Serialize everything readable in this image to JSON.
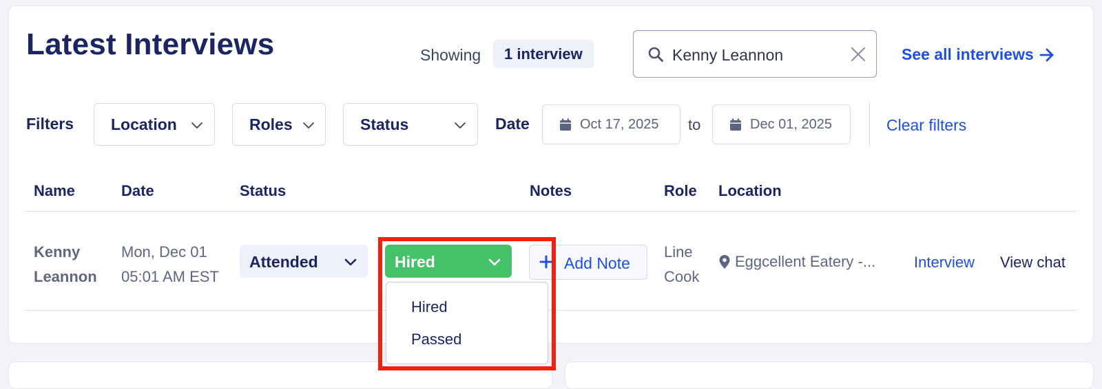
{
  "header": {
    "title": "Latest Interviews",
    "showing_label": "Showing",
    "count_badge": "1 interview",
    "see_all": "See all interviews"
  },
  "search": {
    "value": "Kenny Leannon",
    "icon": "search-icon",
    "clear_icon": "close-icon"
  },
  "filters": {
    "label": "Filters",
    "location": "Location",
    "roles": "Roles",
    "status": "Status",
    "date_label": "Date",
    "date_from": "Oct 17, 2025",
    "to_label": "to",
    "date_to": "Dec 01, 2025",
    "clear": "Clear filters"
  },
  "table": {
    "columns": {
      "name": "Name",
      "date": "Date",
      "status": "Status",
      "notes": "Notes",
      "role": "Role",
      "location": "Location"
    },
    "rows": [
      {
        "name_first": "Kenny",
        "name_last": "Leannon",
        "date_line1": "Mon, Dec 01",
        "date_line2": "05:01 AM EST",
        "attendance": "Attended",
        "outcome": "Hired",
        "add_note": "Add Note",
        "role_line1": "Line",
        "role_line2": "Cook",
        "location": "Eggcellent Eatery -...",
        "interview_link": "Interview",
        "view_chat": "View chat"
      }
    ]
  },
  "outcome_menu": {
    "options": [
      "Hired",
      "Passed"
    ]
  },
  "colors": {
    "accent": "#1f4fe0",
    "hired": "#45c16a",
    "highlight": "#f0210f",
    "text_dark": "#1b2561"
  }
}
